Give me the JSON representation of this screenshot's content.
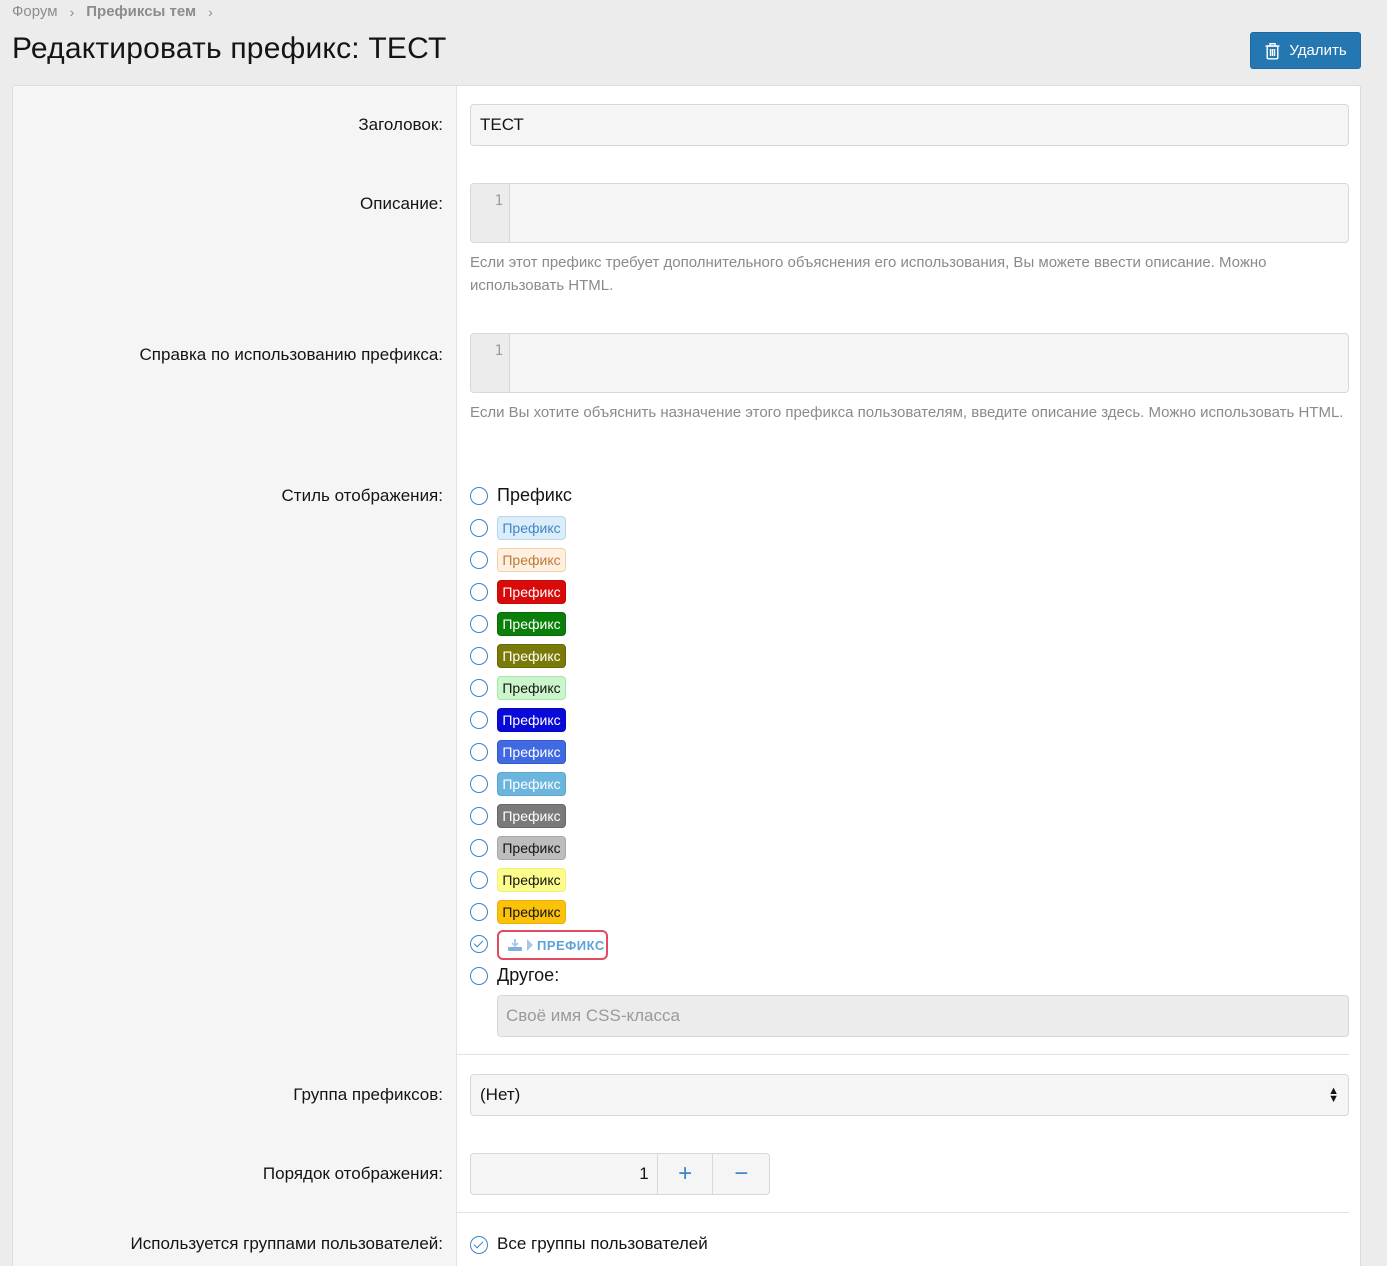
{
  "breadcrumb": {
    "items": [
      "Форум",
      "Префиксы тем"
    ],
    "separator": "›"
  },
  "page": {
    "title": "Редактировать префикс: ТЕСТ"
  },
  "toolbar": {
    "delete_label": "Удалить"
  },
  "form": {
    "title": {
      "label": "Заголовок:",
      "value": "ТЕСТ"
    },
    "description": {
      "label": "Описание:",
      "line_number": "1",
      "hint": "Если этот префикс требует дополнительного объяснения его использования, Вы можете ввести описание. Можно использовать HTML."
    },
    "usage_help": {
      "label": "Справка по использованию префикса:",
      "line_number": "1",
      "hint": "Если Вы хотите объяснить назначение этого префикса пользователям, введите описание здесь. Можно использовать HTML."
    },
    "display_style": {
      "label": "Стиль отображения:",
      "plain_option": "Префикс",
      "chip_text": "Префикс",
      "special_text": "ПРЕФИКС",
      "other_label": "Другое:",
      "css_placeholder": "Своё имя CSS-класса",
      "selected_index": 14,
      "chips": [
        {
          "bg": "#dcedfa",
          "fg": "#3f84c8",
          "border": "#b8d6f0"
        },
        {
          "bg": "#fdf0e3",
          "fg": "#c07a30",
          "border": "#f3cfa6"
        },
        {
          "bg": "#d80a0a",
          "fg": "#ffffff",
          "border": "#c50808"
        },
        {
          "bg": "#0a7f0a",
          "fg": "#ffffff",
          "border": "#086b08"
        },
        {
          "bg": "#7a7a08",
          "fg": "#ffffff",
          "border": "#676706"
        },
        {
          "bg": "#cbf6cb",
          "fg": "#141414",
          "border": "#a8e5a8"
        },
        {
          "bg": "#0a0ad8",
          "fg": "#ffffff",
          "border": "#0808c0"
        },
        {
          "bg": "#4169e1",
          "fg": "#ffffff",
          "border": "#3558c8"
        },
        {
          "bg": "#6bb5de",
          "fg": "#ffffff",
          "border": "#5aa4cd"
        },
        {
          "bg": "#7a7a7a",
          "fg": "#ffffff",
          "border": "#676767"
        },
        {
          "bg": "#bdbdbd",
          "fg": "#141414",
          "border": "#a8a8a8"
        },
        {
          "bg": "#fcfc8c",
          "fg": "#141414",
          "border": "#f0f07a"
        },
        {
          "bg": "#fcc20a",
          "fg": "#141414",
          "border": "#e8b008"
        }
      ]
    },
    "prefix_group": {
      "label": "Группа префиксов:",
      "value": "(Нет)"
    },
    "display_order": {
      "label": "Порядок отображения:",
      "value": "1",
      "plus": "+",
      "minus": "−"
    },
    "user_groups": {
      "label": "Используется группами пользователей:",
      "option": "Все группы пользователей"
    }
  }
}
